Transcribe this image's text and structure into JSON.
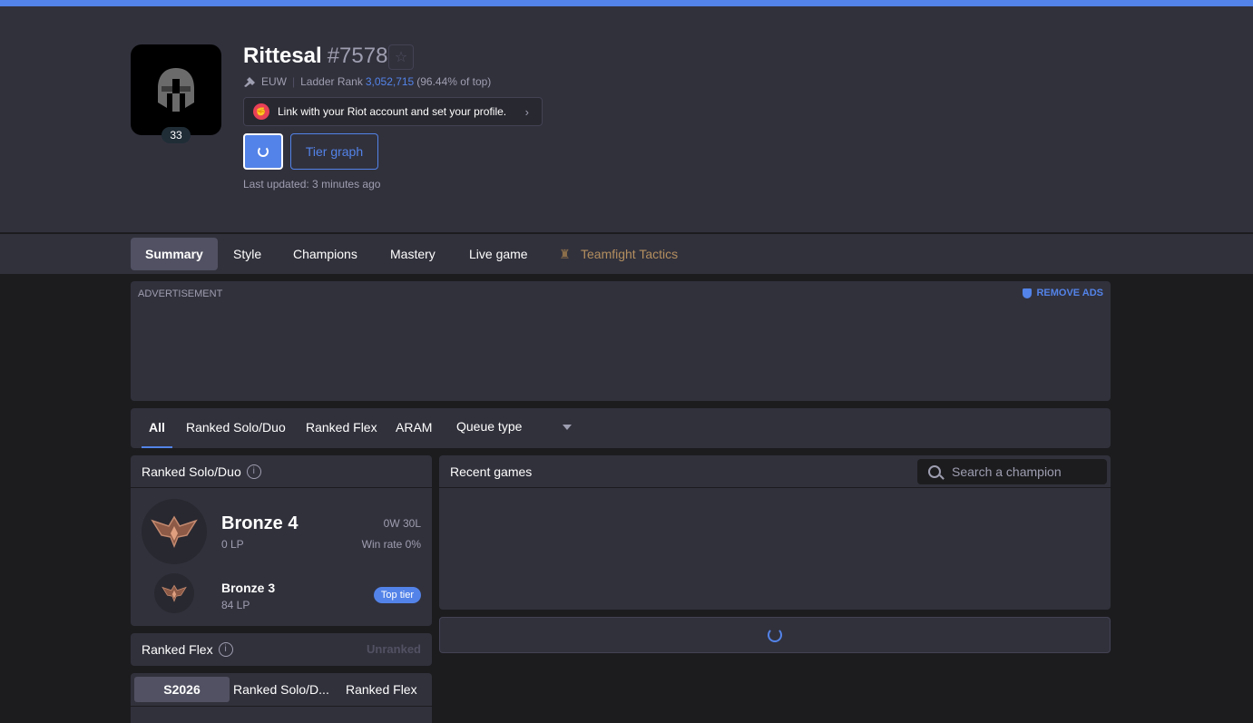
{
  "profile": {
    "name": "Rittesal",
    "tag": "#7578",
    "level": "33",
    "region": "EUW",
    "ladder_rank_label": "Ladder Rank",
    "ladder_rank": "3,052,715",
    "ladder_percent": "(96.44% of top)",
    "riot_link_text": "Link with your Riot account and set your profile.",
    "riot_icon": "riot-fist-icon",
    "tier_graph_label": "Tier graph",
    "last_updated": "Last updated: 3 minutes ago"
  },
  "nav": {
    "items": [
      "Summary",
      "Style",
      "Champions",
      "Mastery",
      "Live game",
      "Teamfight Tactics"
    ],
    "active": "Summary"
  },
  "ad": {
    "label": "ADVERTISEMENT",
    "remove_label": "REMOVE ADS"
  },
  "queue_tabs": {
    "items": [
      "All",
      "Ranked Solo/Duo",
      "Ranked Flex",
      "ARAM"
    ],
    "active": "All",
    "select_label": "Queue type"
  },
  "ranked_solo": {
    "title": "Ranked Solo/Duo",
    "tier": "Bronze 4",
    "lp": "0 LP",
    "record": "0W 30L",
    "win_rate": "Win rate 0%",
    "peak_tier": "Bronze 3",
    "peak_lp": "84 LP",
    "badge": "Top tier"
  },
  "ranked_flex": {
    "title": "Ranked Flex",
    "status": "Unranked"
  },
  "season_tabs": {
    "items": [
      "S2026",
      "Ranked Solo/D...",
      "Ranked Flex"
    ],
    "active": "S2026"
  },
  "recent_games": {
    "title": "Recent games",
    "search_placeholder": "Search a champion"
  },
  "colors": {
    "accent": "#5383e8",
    "background": "#1c1c1f",
    "panel": "#31313c",
    "tft_gold": "#b38e5f",
    "riot_red": "#e84057"
  }
}
